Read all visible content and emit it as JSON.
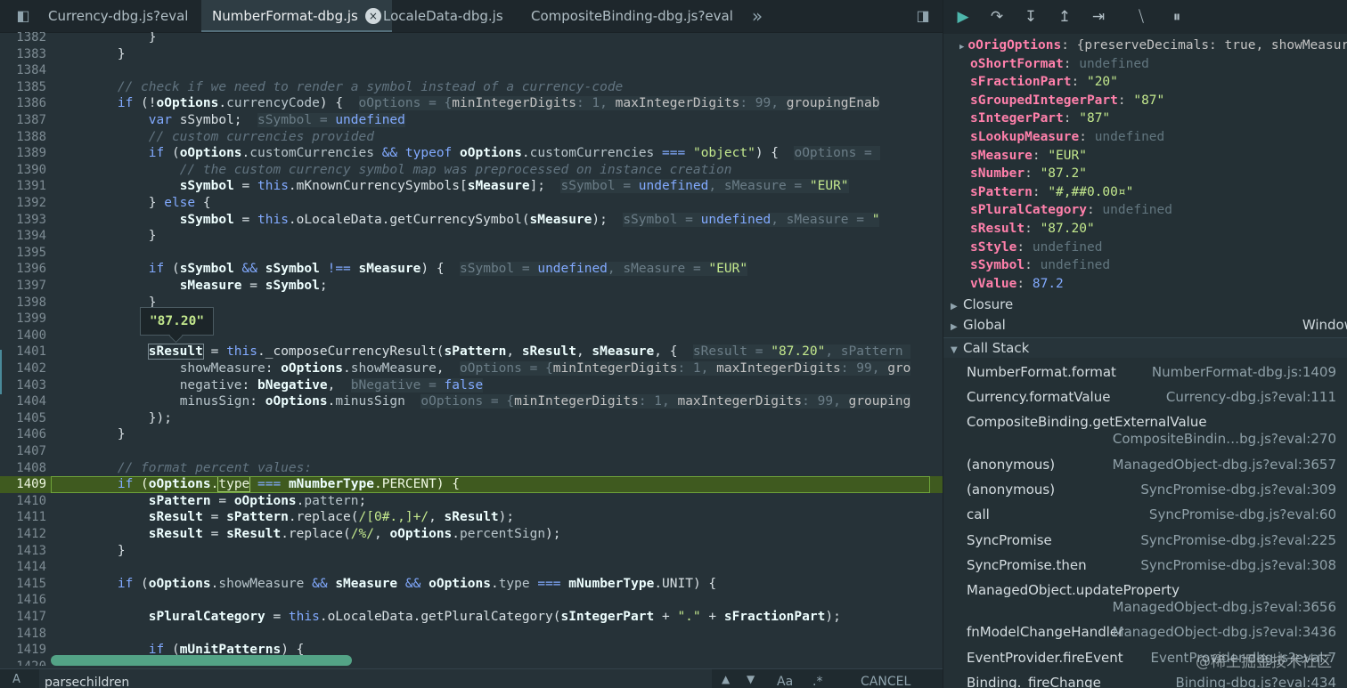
{
  "tabs": [
    {
      "label": "Currency-dbg.js?eval",
      "active": false
    },
    {
      "label": "NumberFormat-dbg.js",
      "active": true
    },
    {
      "label": "LocaleData-dbg.js",
      "active": false
    },
    {
      "label": "CompositeBinding-dbg.js?eval",
      "active": false
    }
  ],
  "tab_close_glyph": "×",
  "more_tabs_glyph": "»",
  "code_lines": [
    {
      "n": "1382",
      "html": "            }"
    },
    {
      "n": "1383",
      "html": "        }"
    },
    {
      "n": "1384",
      "html": ""
    },
    {
      "n": "1385",
      "html": "        <span class=\"cm\">// check if we need to render a symbol instead of a currency-code</span>"
    },
    {
      "n": "1386",
      "html": "        <span class=\"kw\">if</span> (!<span class=\"bold\">oOptions</span>.<span class=\"prop\">currencyCode</span>) {  <span class=\"inl\">oOptions = {<span class=\"k\">minIntegerDigits</span>: 1, <span class=\"k\">maxIntegerDigits</span>: 99, <span class=\"k\">groupingEnab</span></span>"
    },
    {
      "n": "1387",
      "html": "            <span class=\"kw\">var</span> sSymbol;  <span class=\"inl\">sSymbol = <span class=\"b\">undefined</span></span>"
    },
    {
      "n": "1388",
      "html": "            <span class=\"cm\">// custom currencies provided</span>"
    },
    {
      "n": "1389",
      "html": "            <span class=\"kw\">if</span> (<span class=\"bold\">oOptions</span>.<span class=\"prop\">customCurrencies</span> <span class=\"kw\">&amp;&amp;</span> <span class=\"kw\">typeof</span> <span class=\"bold\">oOptions</span>.<span class=\"prop\">customCurrencies</span> <span class=\"kw\">===</span> <span class=\"str\">\"object\"</span>) {  <span class=\"inl\">oOptions = </span>"
    },
    {
      "n": "1390",
      "html": "                <span class=\"cm\">// the custom currency symbol map was preprocessed on instance creation</span>"
    },
    {
      "n": "1391",
      "html": "                <span class=\"bold\">sSymbol</span> = <span class=\"kw\">this</span>.mKnownCurrencySymbols[<span class=\"bold\">sMeasure</span>];  <span class=\"inl\">sSymbol = <span class=\"b\">undefined</span>, sMeasure = <span class=\"v\">\"EUR\"</span></span>"
    },
    {
      "n": "1392",
      "html": "            } <span class=\"kw\">else</span> {"
    },
    {
      "n": "1393",
      "html": "                <span class=\"bold\">sSymbol</span> = <span class=\"kw\">this</span>.oLocaleData.getCurrencySymbol(<span class=\"bold\">sMeasure</span>);  <span class=\"inl\">sSymbol = <span class=\"b\">undefined</span>, sMeasure = <span class=\"v\">\"</span></span>"
    },
    {
      "n": "1394",
      "html": "            }"
    },
    {
      "n": "1395",
      "html": ""
    },
    {
      "n": "1396",
      "html": "            <span class=\"kw\">if</span> (<span class=\"bold\">sSymbol</span> <span class=\"kw\">&amp;&amp;</span> <span class=\"bold\">sSymbol</span> <span class=\"kw\">!==</span> <span class=\"bold\">sMeasure</span>) {  <span class=\"inl\">sSymbol = <span class=\"b\">undefined</span>, sMeasure = <span class=\"v\">\"EUR\"</span></span>"
    },
    {
      "n": "1397",
      "html": "                <span class=\"bold\">sMeasure</span> = <span class=\"bold\">sSymbol</span>;"
    },
    {
      "n": "1398",
      "html": "            }"
    },
    {
      "n": "1399",
      "html": ""
    },
    {
      "n": "1400",
      "html": ""
    },
    {
      "n": "1401",
      "html": "            <span class=\"bold\" style=\"outline:1px solid #7a8a92\">sResult</span> = <span class=\"kw\">this</span>._composeCurrencyResult(<span class=\"bold\">sPattern</span>, <span class=\"bold\">sResult</span>, <span class=\"bold\">sMeasure</span>, {  <span class=\"inl\">sResult = <span class=\"v\">\"87.20\"</span>, sPattern </span>"
    },
    {
      "n": "1402",
      "html": "                <span class=\"prop\">showMeasure</span>: <span class=\"bold\">oOptions</span>.<span class=\"prop\">showMeasure</span>,  <span class=\"inl\">oOptions = {<span class=\"k\">minIntegerDigits</span>: 1, <span class=\"k\">maxIntegerDigits</span>: 99, <span class=\"k\">gro</span></span>"
    },
    {
      "n": "1403",
      "html": "                <span class=\"prop\">negative</span>: <span class=\"bold\">bNegative</span>,  <span class=\"inl\">bNegative = <span class=\"b\">false</span></span>"
    },
    {
      "n": "1404",
      "html": "                <span class=\"prop\">minusSign</span>: <span class=\"bold\">oOptions</span>.<span class=\"prop\">minusSign</span>  <span class=\"inl\">oOptions = {<span class=\"k\">minIntegerDigits</span>: 1, <span class=\"k\">maxIntegerDigits</span>: 99, <span class=\"k\">grouping</span></span>"
    },
    {
      "n": "1405",
      "html": "            });"
    },
    {
      "n": "1406",
      "html": "        }"
    },
    {
      "n": "1407",
      "html": ""
    },
    {
      "n": "1408",
      "html": "        <span class=\"cm\">// format percent values:</span>"
    },
    {
      "n": "1409",
      "html": "        <span class=\"kw\">if</span> (<span class=\"bold\">oOptions</span>.<span style=\"outline:1px solid #9fc76b\">type</span> <span class=\"kw\">===</span> <span class=\"bold\">mNumberType</span>.PERCENT) {",
      "hl": true
    },
    {
      "n": "1410",
      "html": "            <span class=\"bold\">sPattern</span> = <span class=\"bold\">oOptions</span>.<span class=\"prop\">pattern</span>;"
    },
    {
      "n": "1411",
      "html": "            <span class=\"bold\">sResult</span> = <span class=\"bold\">sPattern</span>.replace(<span class=\"str\">/[0#.,]+/</span>, <span class=\"bold\">sResult</span>);"
    },
    {
      "n": "1412",
      "html": "            <span class=\"bold\">sResult</span> = <span class=\"bold\">sResult</span>.replace(<span class=\"str\">/%/</span>, <span class=\"bold\">oOptions</span>.<span class=\"prop\">percentSign</span>);"
    },
    {
      "n": "1413",
      "html": "        }"
    },
    {
      "n": "1414",
      "html": ""
    },
    {
      "n": "1415",
      "html": "        <span class=\"kw\">if</span> (<span class=\"bold\">oOptions</span>.<span class=\"prop\">showMeasure</span> <span class=\"kw\">&amp;&amp;</span> <span class=\"bold\">sMeasure</span> <span class=\"kw\">&amp;&amp;</span> <span class=\"bold\">oOptions</span>.<span class=\"prop\">type</span> <span class=\"kw\">===</span> <span class=\"bold\">mNumberType</span>.UNIT) {"
    },
    {
      "n": "1416",
      "html": ""
    },
    {
      "n": "1417",
      "html": "            <span class=\"bold\">sPluralCategory</span> = <span class=\"kw\">this</span>.oLocaleData.getPluralCategory(<span class=\"bold\">sIntegerPart</span> + <span class=\"str\">\".\"</span> + <span class=\"bold\">sFractionPart</span>);"
    },
    {
      "n": "1418",
      "html": ""
    },
    {
      "n": "1419",
      "html": "            <span class=\"kw\">if</span> (<span class=\"bold\">mUnitPatterns</span>) {"
    },
    {
      "n": "1420",
      "html": ""
    }
  ],
  "tooltip_value": "\"87.20\"",
  "search": {
    "label": "A",
    "value": "parsechildren",
    "case_label": "Aa",
    "regex_label": ".*",
    "cancel_label": "CANCEL"
  },
  "scope_vars": [
    {
      "name": "oOrigOptions",
      "value": "{preserveDecimals: true, showMeasure",
      "type": "obj",
      "expandable": true
    },
    {
      "name": "oShortFormat",
      "value": "undefined",
      "type": "undef"
    },
    {
      "name": "sFractionPart",
      "value": "\"20\"",
      "type": "str"
    },
    {
      "name": "sGroupedIntegerPart",
      "value": "\"87\"",
      "type": "str"
    },
    {
      "name": "sIntegerPart",
      "value": "\"87\"",
      "type": "str"
    },
    {
      "name": "sLookupMeasure",
      "value": "undefined",
      "type": "undef"
    },
    {
      "name": "sMeasure",
      "value": "\"EUR\"",
      "type": "str"
    },
    {
      "name": "sNumber",
      "value": "\"87.2\"",
      "type": "str"
    },
    {
      "name": "sPattern",
      "value": "\"#,##0.00¤\"",
      "type": "str"
    },
    {
      "name": "sPluralCategory",
      "value": "undefined",
      "type": "undef"
    },
    {
      "name": "sResult",
      "value": "\"87.20\"",
      "type": "str"
    },
    {
      "name": "sStyle",
      "value": "undefined",
      "type": "undef"
    },
    {
      "name": "sSymbol",
      "value": "undefined",
      "type": "undef"
    },
    {
      "name": "vValue",
      "value": "87.2",
      "type": "num"
    }
  ],
  "closure_label": "Closure",
  "global_label": "Global",
  "global_value": "Window",
  "call_stack_label": "Call Stack",
  "call_stack": [
    {
      "fn": "NumberFormat.format",
      "loc": "NumberFormat-dbg.js:1409"
    },
    {
      "fn": "Currency.formatValue",
      "loc": "Currency-dbg.js?eval:111"
    },
    {
      "fn": "CompositeBinding.getExternalValue",
      "loc": "CompositeBindin…bg.js?eval:270",
      "wrap": true
    },
    {
      "fn": "(anonymous)",
      "loc": "ManagedObject-dbg.js?eval:3657"
    },
    {
      "fn": "(anonymous)",
      "loc": "SyncPromise-dbg.js?eval:309"
    },
    {
      "fn": "call",
      "loc": "SyncPromise-dbg.js?eval:60"
    },
    {
      "fn": "SyncPromise",
      "loc": "SyncPromise-dbg.js?eval:225"
    },
    {
      "fn": "SyncPromise.then",
      "loc": "SyncPromise-dbg.js?eval:308"
    },
    {
      "fn": "ManagedObject.updateProperty",
      "loc": "ManagedObject-dbg.js?eval:3656",
      "wrap": true
    },
    {
      "fn": "fnModelChangeHandler",
      "loc": "ManagedObject-dbg.js?eval:3436"
    },
    {
      "fn": "EventProvider.fireEvent",
      "loc": "EventProvider-dbg.js?eval:7"
    },
    {
      "fn": "Binding._fireChange",
      "loc": "Binding-dbg.js?eval:434"
    }
  ],
  "watermark": "@稀土掘金技术社区"
}
